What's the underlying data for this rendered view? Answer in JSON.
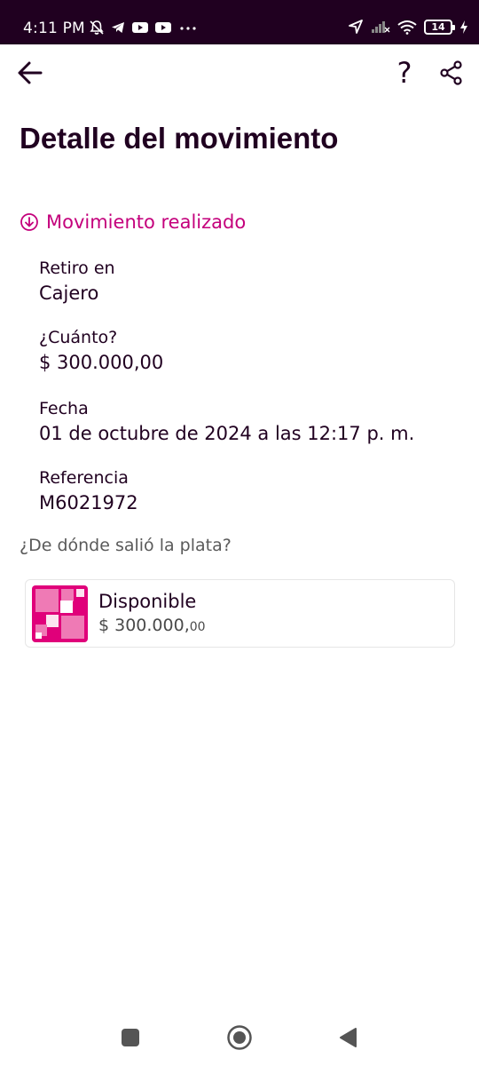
{
  "status_bar": {
    "time": "4:11 PM",
    "battery": "14",
    "icons": [
      "bell-muted-icon",
      "telegram-icon",
      "youtube-icon",
      "youtube-icon",
      "more-icon",
      "location-icon",
      "signal-icon",
      "wifi-icon",
      "battery-icon",
      "charging-icon"
    ]
  },
  "header": {
    "back_icon": "arrow-left-icon",
    "help_label": "?",
    "share_icon": "share-icon"
  },
  "page": {
    "title": "Detalle del movimiento",
    "status": "Movimiento realizado",
    "status_color": "#c4007c"
  },
  "details": [
    {
      "label": "Retiro en",
      "value": "Cajero"
    },
    {
      "label": "¿Cuánto?",
      "value": "$ 300.000,00"
    },
    {
      "label": "Fecha",
      "value": "01 de octubre de 2024 a las 12:17 p. m."
    },
    {
      "label": "Referencia",
      "value": "M6021972"
    }
  ],
  "source": {
    "question": "¿De dónde salió la plata?",
    "account_name": "Disponible",
    "amount_main": "$ 300.000,",
    "amount_cents": "00",
    "brand_color": "#e0007a"
  },
  "nav": {
    "icons": [
      "recents-square-icon",
      "home-circle-icon",
      "back-triangle-icon"
    ]
  }
}
